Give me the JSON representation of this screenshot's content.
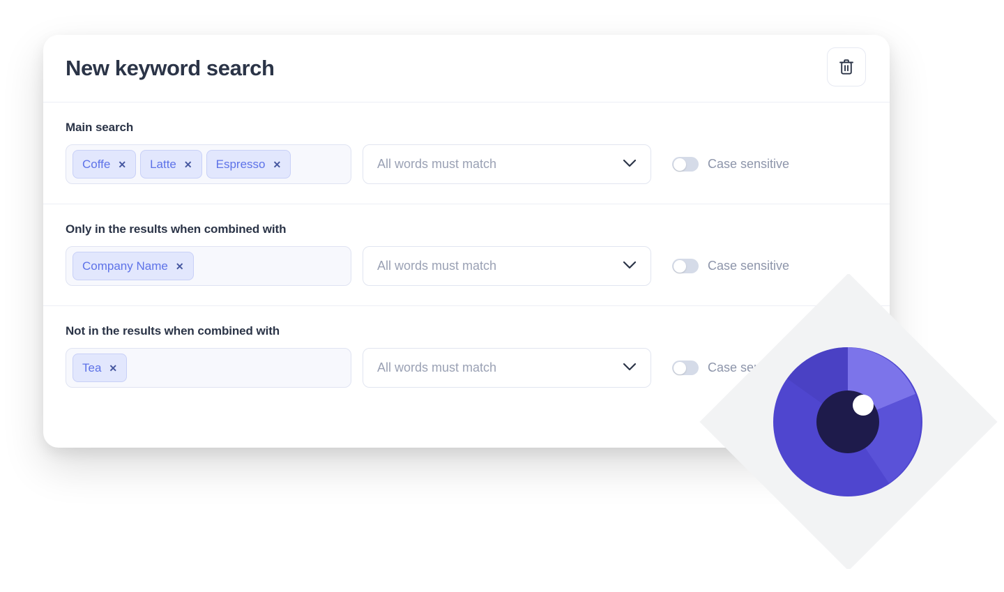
{
  "card": {
    "title": "New keyword search",
    "delete_icon": "trash-icon"
  },
  "sections": [
    {
      "label": "Main search",
      "chips": [
        "Coffe",
        "Latte",
        "Espresso"
      ],
      "chip_remove_glyph": "✕",
      "match_mode": "All words must match",
      "chevron_icon": "chevron-down-icon",
      "case_sensitive_label": "Case sensitive",
      "case_sensitive_on": false
    },
    {
      "label": "Only in the results when combined with",
      "chips": [
        "Company Name"
      ],
      "chip_remove_glyph": "✕",
      "match_mode": "All words must match",
      "chevron_icon": "chevron-down-icon",
      "case_sensitive_label": "Case sensitive",
      "case_sensitive_on": false
    },
    {
      "label": "Not in the results when combined with",
      "chips": [
        "Tea"
      ],
      "chip_remove_glyph": "✕",
      "match_mode": "All words must match",
      "chevron_icon": "chevron-down-icon",
      "case_sensitive_label": "Case sensitive",
      "case_sensitive_on": false
    }
  ],
  "decoration": {
    "name": "eye-illustration",
    "plate_color": "#f2f3f4",
    "iris_main_color": "#4f46cf",
    "iris_light_color": "#7c74ea",
    "iris_mid_color": "#5a52d8",
    "pupil_color": "#1e1b4b",
    "highlight_color": "#ffffff"
  },
  "colors": {
    "card_background": "#ffffff",
    "title_text": "#2b3447",
    "chip_background": "#e2e7fd",
    "chip_text": "#5d72e8",
    "chip_border": "#c8d0f7",
    "input_background": "#f7f8fd",
    "input_border": "#dfe3f2",
    "placeholder_text": "#9aa1b4",
    "muted_text": "#8d95aa",
    "divider": "#eceef5",
    "toggle_track_off": "#d5dbe8"
  }
}
